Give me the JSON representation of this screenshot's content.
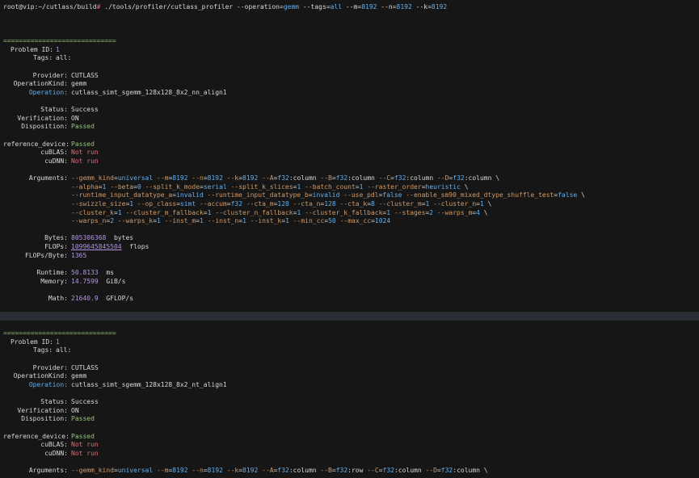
{
  "prompt": {
    "user_host": "root@vip",
    "path": "~/cutlass/build",
    "symbol": "#",
    "cmd": "./tools/profiler/cutlass_profiler",
    "args": [
      {
        "flag": "--operation",
        "value": "gemm"
      },
      {
        "flag": "--tags",
        "value": "all"
      },
      {
        "flag": "--m",
        "value": "8192"
      },
      {
        "flag": "--n",
        "value": "8192"
      },
      {
        "flag": "--k",
        "value": "8192"
      }
    ]
  },
  "separator": "=============================",
  "blocks": [
    {
      "problem_id_label": "Problem ID:",
      "problem_id": "1",
      "tags_label": "Tags:",
      "tags": "all:",
      "provider_label": "Provider:",
      "provider": "CUTLASS",
      "opkind_label": "OperationKind:",
      "opkind": "gemm",
      "operation_label": "Operation:",
      "operation": "cutlass_simt_sgemm_128x128_8x2_nn_align1",
      "status_label": "Status:",
      "status": "Success",
      "verification_label": "Verification:",
      "verification": "ON",
      "disposition_label": "Disposition:",
      "disposition": "Passed",
      "refdev_label": "reference_device:",
      "refdev": "Passed",
      "cublas_label": "cuBLAS:",
      "cublas": "Not run",
      "cudnn_label": "cuDNN:",
      "cudnn": "Not run",
      "arguments_label": "Arguments:",
      "arg_lines": [
        [
          [
            "--gemm_kind",
            "universal"
          ],
          [
            "--m",
            "8192"
          ],
          [
            "--n",
            "8192"
          ],
          [
            "--k",
            "8192"
          ],
          [
            "--A",
            "f32",
            ":column"
          ],
          [
            "--B",
            "f32",
            ":column"
          ],
          [
            "--C",
            "f32",
            ":column"
          ],
          [
            "--D",
            "f32",
            ":column"
          ],
          [
            "\\"
          ]
        ],
        [
          [
            "--alpha",
            "1"
          ],
          [
            "--beta",
            "0"
          ],
          [
            "--split_k_mode",
            "serial"
          ],
          [
            "--split_k_slices",
            "1"
          ],
          [
            "--batch_count",
            "1"
          ],
          [
            "--raster_order",
            "heuristic"
          ],
          [
            "\\"
          ]
        ],
        [
          [
            "--runtime_input_datatype_a",
            "invalid"
          ],
          [
            "--runtime_input_datatype_b",
            "invalid"
          ],
          [
            "--use_pdl",
            "false"
          ],
          [
            "--enable_sm90_mixed_dtype_shuffle_test",
            "false"
          ],
          [
            "\\"
          ]
        ],
        [
          [
            "--swizzle_size",
            "1"
          ],
          [
            "--op_class",
            "simt"
          ],
          [
            "--accum",
            "f32"
          ],
          [
            "--cta_m",
            "128"
          ],
          [
            "--cta_n",
            "128"
          ],
          [
            "--cta_k",
            "8"
          ],
          [
            "--cluster_m",
            "1"
          ],
          [
            "--cluster_n",
            "1"
          ],
          [
            "\\"
          ]
        ],
        [
          [
            "--cluster_k",
            "1"
          ],
          [
            "--cluster_m_fallback",
            "1"
          ],
          [
            "--cluster_n_fallback",
            "1"
          ],
          [
            "--cluster_k_fallback",
            "1"
          ],
          [
            "--stages",
            "2"
          ],
          [
            "--warps_m",
            "4"
          ],
          [
            "\\"
          ]
        ],
        [
          [
            "--warps_n",
            "2"
          ],
          [
            "--warps_k",
            "1"
          ],
          [
            "--inst_m",
            "1"
          ],
          [
            "--inst_n",
            "1"
          ],
          [
            "--inst_k",
            "1"
          ],
          [
            "--min_cc",
            "50"
          ],
          [
            "--max_cc",
            "1024"
          ]
        ]
      ],
      "bytes_label": "Bytes:",
      "bytes": "805306368",
      "bytes_unit": "bytes",
      "flops_label": "FLOPs:",
      "flops": "1099645845504",
      "flops_unit": "flops",
      "fpb_label": "FLOPs/Byte:",
      "fpb": "1365",
      "runtime_label": "Runtime:",
      "runtime": "50.8133",
      "runtime_unit": "ms",
      "memory_label": "Memory:",
      "memory": "14.7599",
      "memory_unit": "GiB/s",
      "math_label": "Math:",
      "math": "21640.9",
      "math_unit": "GFLOP/s"
    },
    {
      "problem_id_label": "Problem ID:",
      "problem_id": "1",
      "tags_label": "Tags:",
      "tags": "all:",
      "provider_label": "Provider:",
      "provider": "CUTLASS",
      "opkind_label": "OperationKind:",
      "opkind": "gemm",
      "operation_label": "Operation:",
      "operation": "cutlass_simt_sgemm_128x128_8x2_nt_align1",
      "status_label": "Status:",
      "status": "Success",
      "verification_label": "Verification:",
      "verification": "ON",
      "disposition_label": "Disposition:",
      "disposition": "Passed",
      "refdev_label": "reference_device:",
      "refdev": "Passed",
      "cublas_label": "cuBLAS:",
      "cublas": "Not run",
      "cudnn_label": "cuDNN:",
      "cudnn": "Not run",
      "arguments_label": "Arguments:",
      "arg_lines": [
        [
          [
            "--gemm_kind",
            "universal"
          ],
          [
            "--m",
            "8192"
          ],
          [
            "--n",
            "8192"
          ],
          [
            "--k",
            "8192"
          ],
          [
            "--A",
            "f32",
            ":column"
          ],
          [
            "--B",
            "f32",
            ":row"
          ],
          [
            "--C",
            "f32",
            ":column"
          ],
          [
            "--D",
            "f32",
            ":column"
          ],
          [
            "\\"
          ]
        ]
      ]
    }
  ]
}
